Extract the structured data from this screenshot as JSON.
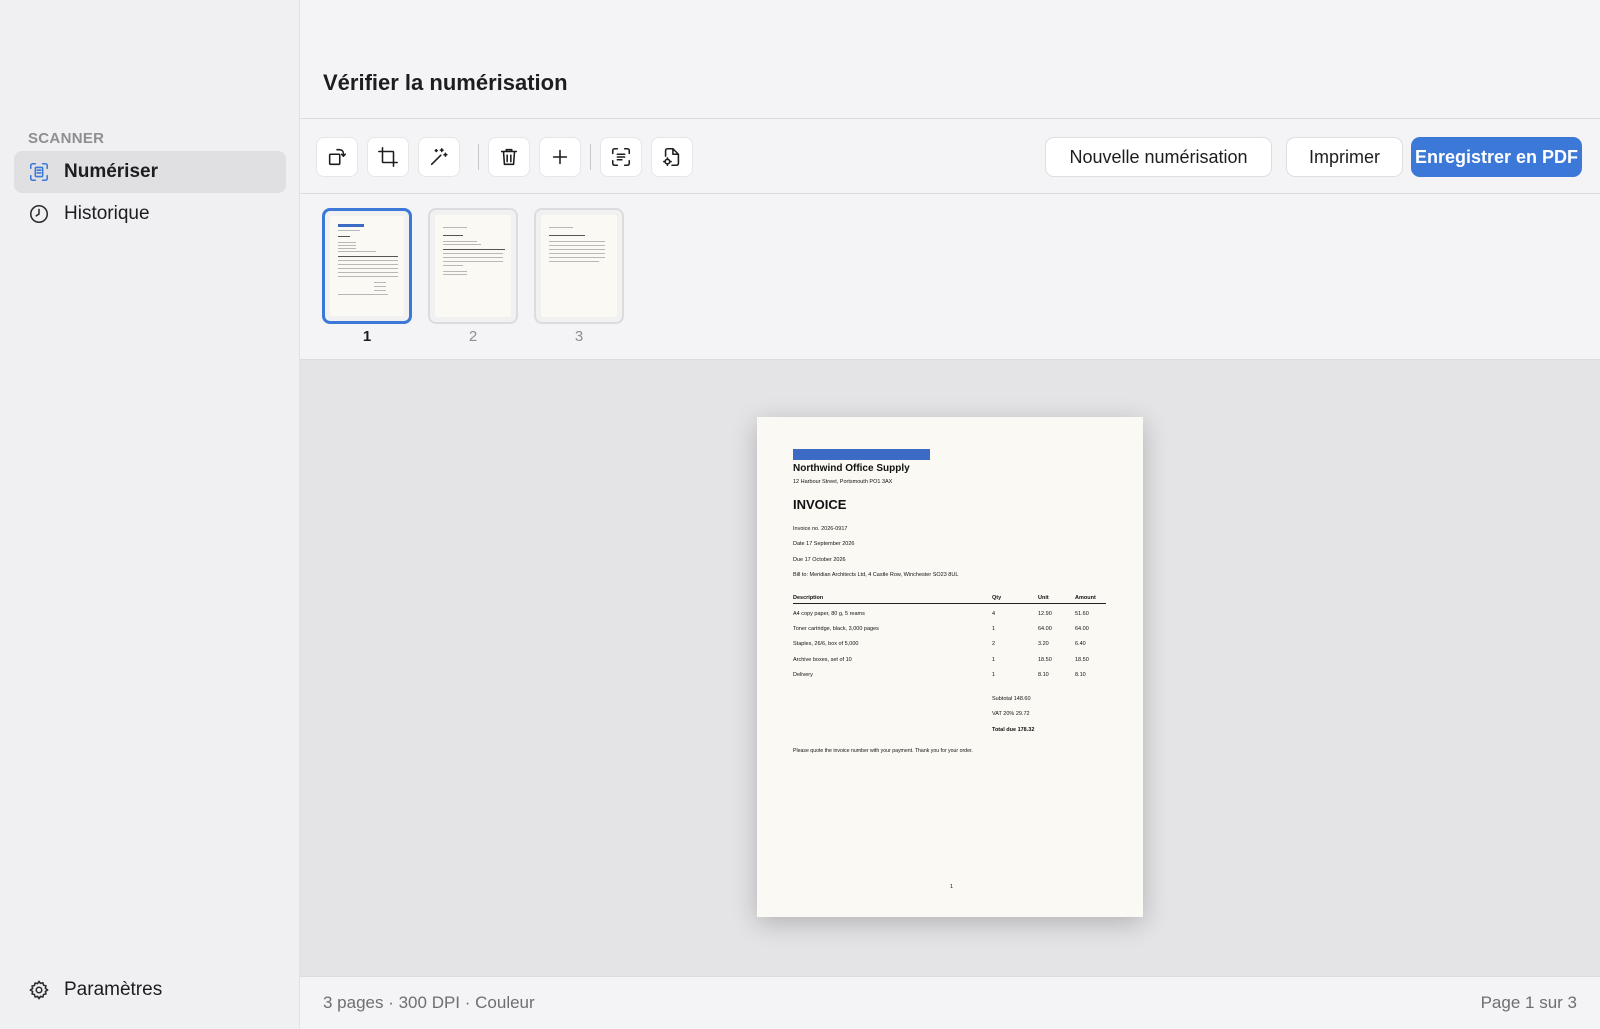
{
  "sidebar": {
    "section": "SCANNER",
    "items": [
      {
        "label": "Numériser",
        "icon": "scan-icon",
        "active": true
      },
      {
        "label": "Historique",
        "icon": "clock-icon",
        "active": false
      }
    ],
    "settings": "Paramètres"
  },
  "header": {
    "title": "Vérifier la numérisation"
  },
  "toolbar": {
    "icons": [
      "rotate-icon",
      "crop-icon",
      "magic-wand-icon",
      "trash-icon",
      "plus-icon",
      "text-recognition-icon",
      "document-settings-icon"
    ],
    "new_scan": "Nouvelle numérisation",
    "print": "Imprimer",
    "save_pdf": "Enregistrer en PDF",
    "accent": "#3b78d8"
  },
  "thumbnails": [
    {
      "number": "1",
      "selected": true
    },
    {
      "number": "2",
      "selected": false
    },
    {
      "number": "3",
      "selected": false
    }
  ],
  "document": {
    "company": "Northwind Office Supply",
    "address": "12 Harbour Street, Portsmouth PO1 3AX",
    "title": "INVOICE",
    "invoice_no": "Invoice no. 2026-0917",
    "date": "Date 17 September 2026",
    "due": "Due 17 October 2026",
    "bill_to": "Bill to: Meridian Architects Ltd, 4 Castle Row, Winchester SO23 8UL",
    "columns": [
      "Description",
      "Qty",
      "Unit",
      "Amount"
    ],
    "rows": [
      [
        "A4 copy paper, 80 g, 5 reams",
        "4",
        "12.90",
        "51.60"
      ],
      [
        "Toner cartridge, black, 3,000 pages",
        "1",
        "64.00",
        "64.00"
      ],
      [
        "Staples, 26/6, box of 5,000",
        "2",
        "3.20",
        "6.40"
      ],
      [
        "Archive boxes, set of 10",
        "1",
        "18.50",
        "18.50"
      ],
      [
        "Delivery",
        "1",
        "8.10",
        "8.10"
      ]
    ],
    "subtotal": "Subtotal 148.60",
    "vat": "VAT 20% 29.72",
    "total": "Total due 178.32",
    "note": "Please quote the invoice number with your payment. Thank you for your order.",
    "page_number": "1",
    "brand_color": "#3b6bc5"
  },
  "status": {
    "left": "3 pages · 300 DPI · Couleur",
    "right": "Page 1 sur 3"
  }
}
